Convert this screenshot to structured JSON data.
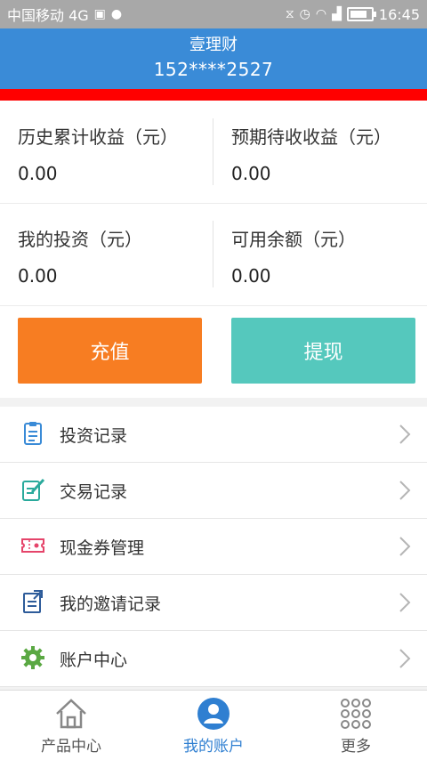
{
  "status_bar": {
    "carrier": "中国移动 4G",
    "time": "16:45"
  },
  "header": {
    "title": "壹理财",
    "phone": "152****2527"
  },
  "stats": [
    {
      "label": "历史累计收益（元）",
      "value": "0.00"
    },
    {
      "label": "预期待收收益（元）",
      "value": "0.00"
    },
    {
      "label": "我的投资（元）",
      "value": "0.00"
    },
    {
      "label": "可用余额（元）",
      "value": "0.00"
    }
  ],
  "actions": {
    "recharge": "充值",
    "withdraw": "提现"
  },
  "menu": [
    {
      "label": "投资记录",
      "icon": "clipboard-icon"
    },
    {
      "label": "交易记录",
      "icon": "edit-document-icon"
    },
    {
      "label": "现金券管理",
      "icon": "coupon-icon"
    },
    {
      "label": "我的邀请记录",
      "icon": "invite-record-icon"
    },
    {
      "label": "账户中心",
      "icon": "gear-icon"
    }
  ],
  "tabs": [
    {
      "label": "产品中心",
      "icon": "home-icon"
    },
    {
      "label": "我的账户",
      "icon": "user-icon",
      "active": true
    },
    {
      "label": "更多",
      "icon": "grid-dots-icon"
    }
  ],
  "colors": {
    "header": "#3a8bd7",
    "accent_red": "#ff0000",
    "recharge": "#f77d22",
    "withdraw": "#55c8bd",
    "active_tab": "#2f7fd1"
  }
}
